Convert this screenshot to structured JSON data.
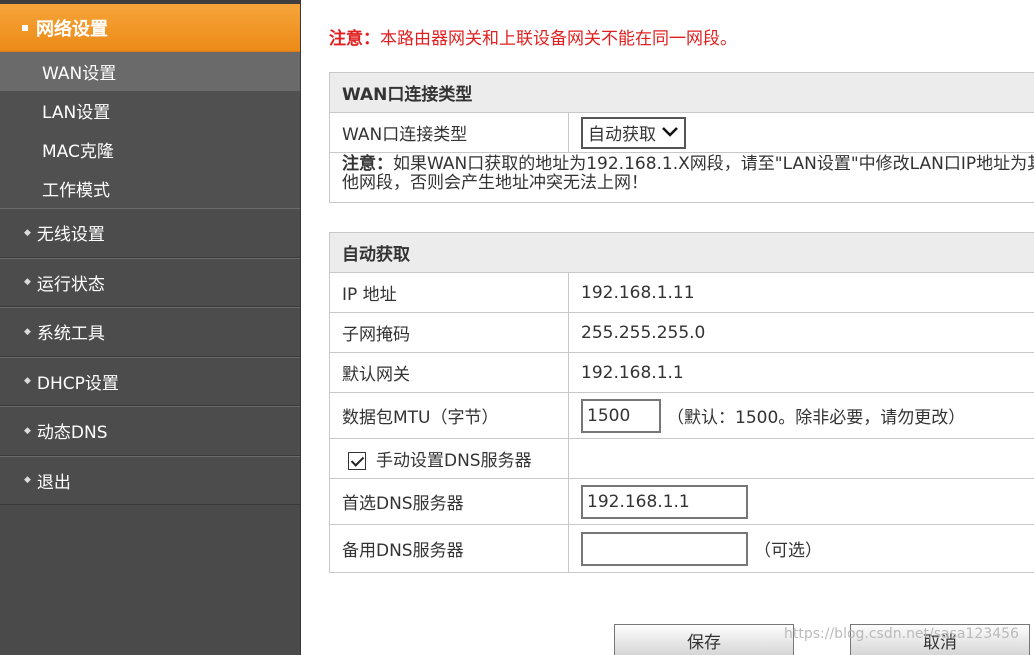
{
  "sidebar": {
    "active_menu": "网络设置",
    "sub_items": [
      "WAN设置",
      "LAN设置",
      "MAC克隆",
      "工作模式"
    ],
    "menu_items": [
      "无线设置",
      "运行状态",
      "系统工具",
      "DHCP设置",
      "动态DNS",
      "退出"
    ]
  },
  "notice_top": {
    "label": "注意：",
    "text": "本路由器网关和上联设备网关不能在同一网段。"
  },
  "wan_type": {
    "header": "WAN口连接类型",
    "label": "WAN口连接类型",
    "selected": "自动获取",
    "note_label": "注意：",
    "note_text": "如果WAN口获取的地址为192.168.1.X网段，请至\"LAN设置\"中修改LAN口IP地址为其他网段，否则会产生地址冲突无法上网！"
  },
  "auto": {
    "header": "自动获取",
    "ip_label": "IP 地址",
    "ip_value": "192.168.1.11",
    "mask_label": "子网掩码",
    "mask_value": "255.255.255.0",
    "gw_label": "默认网关",
    "gw_value": "192.168.1.1",
    "mtu_label": "数据包MTU（字节）",
    "mtu_value": "1500",
    "mtu_hint": "（默认：1500。除非必要，请勿更改）",
    "dns_manual_label": "手动设置DNS服务器",
    "dns_manual_checked": true,
    "dns1_label": "首选DNS服务器",
    "dns1_value": "192.168.1.1",
    "dns2_label": "备用DNS服务器",
    "dns2_value": "",
    "dns2_hint": "（可选）"
  },
  "buttons": {
    "save": "保存",
    "cancel": "取消"
  },
  "watermark": "https://blog.csdn.net/sasa123456"
}
